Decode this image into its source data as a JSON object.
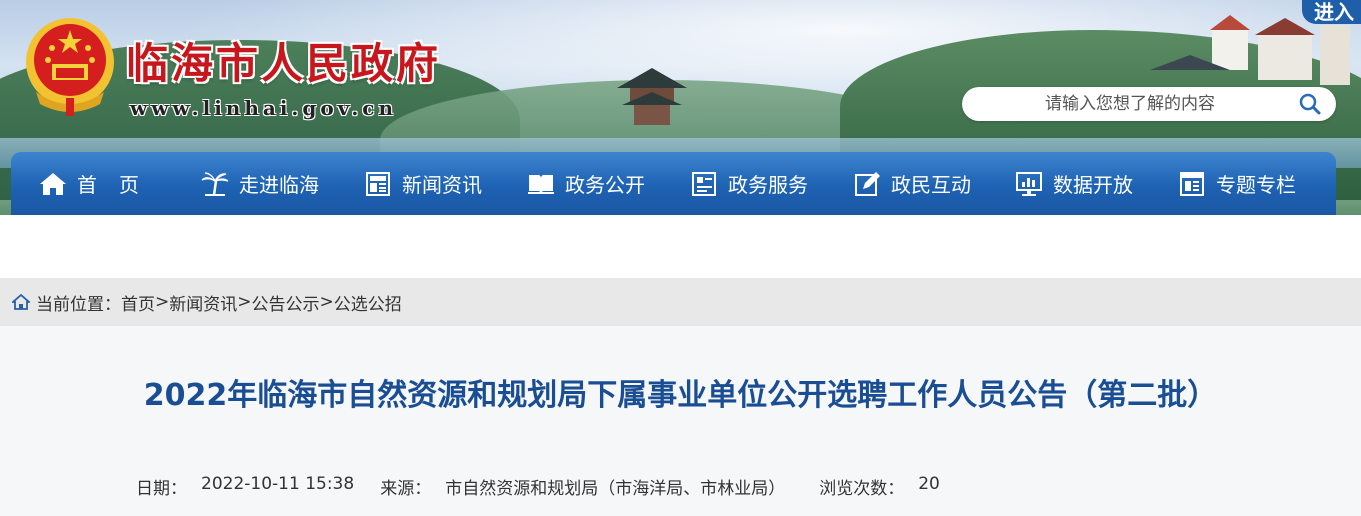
{
  "header": {
    "site_title": "临海市人民政府",
    "site_url": "www.linhai.gov.cn",
    "corner_tab": "进入",
    "search_placeholder": "请输入您想了解的内容"
  },
  "nav": {
    "items": [
      {
        "label": "首页",
        "icon": "home-icon"
      },
      {
        "label": "走进临海",
        "icon": "palm-tree-icon"
      },
      {
        "label": "新闻资讯",
        "icon": "newspaper-icon"
      },
      {
        "label": "政务公开",
        "icon": "open-book-icon"
      },
      {
        "label": "政务服务",
        "icon": "service-icon"
      },
      {
        "label": "政民互动",
        "icon": "edit-icon"
      },
      {
        "label": "数据开放",
        "icon": "monitor-chart-icon"
      },
      {
        "label": "专题专栏",
        "icon": "columns-icon"
      }
    ]
  },
  "breadcrumb": {
    "prefix": "当前位置：",
    "items": [
      "首页",
      "新闻资讯",
      "公告公示",
      "公选公招"
    ],
    "separator": ">"
  },
  "article": {
    "title": "2022年临海市自然资源和规划局下属事业单位公开选聘工作人员公告（第二批）",
    "date_label": "日期：",
    "date_value": "2022-10-11 15:38",
    "source_label": "来源：",
    "source_value": "市自然资源和规划局（市海洋局、市林业局）",
    "views_label": "浏览次数：",
    "views_value": "20"
  },
  "colors": {
    "title_red": "#c8161d",
    "nav_blue": "#1e62b3",
    "article_title_blue": "#1a4e94"
  }
}
